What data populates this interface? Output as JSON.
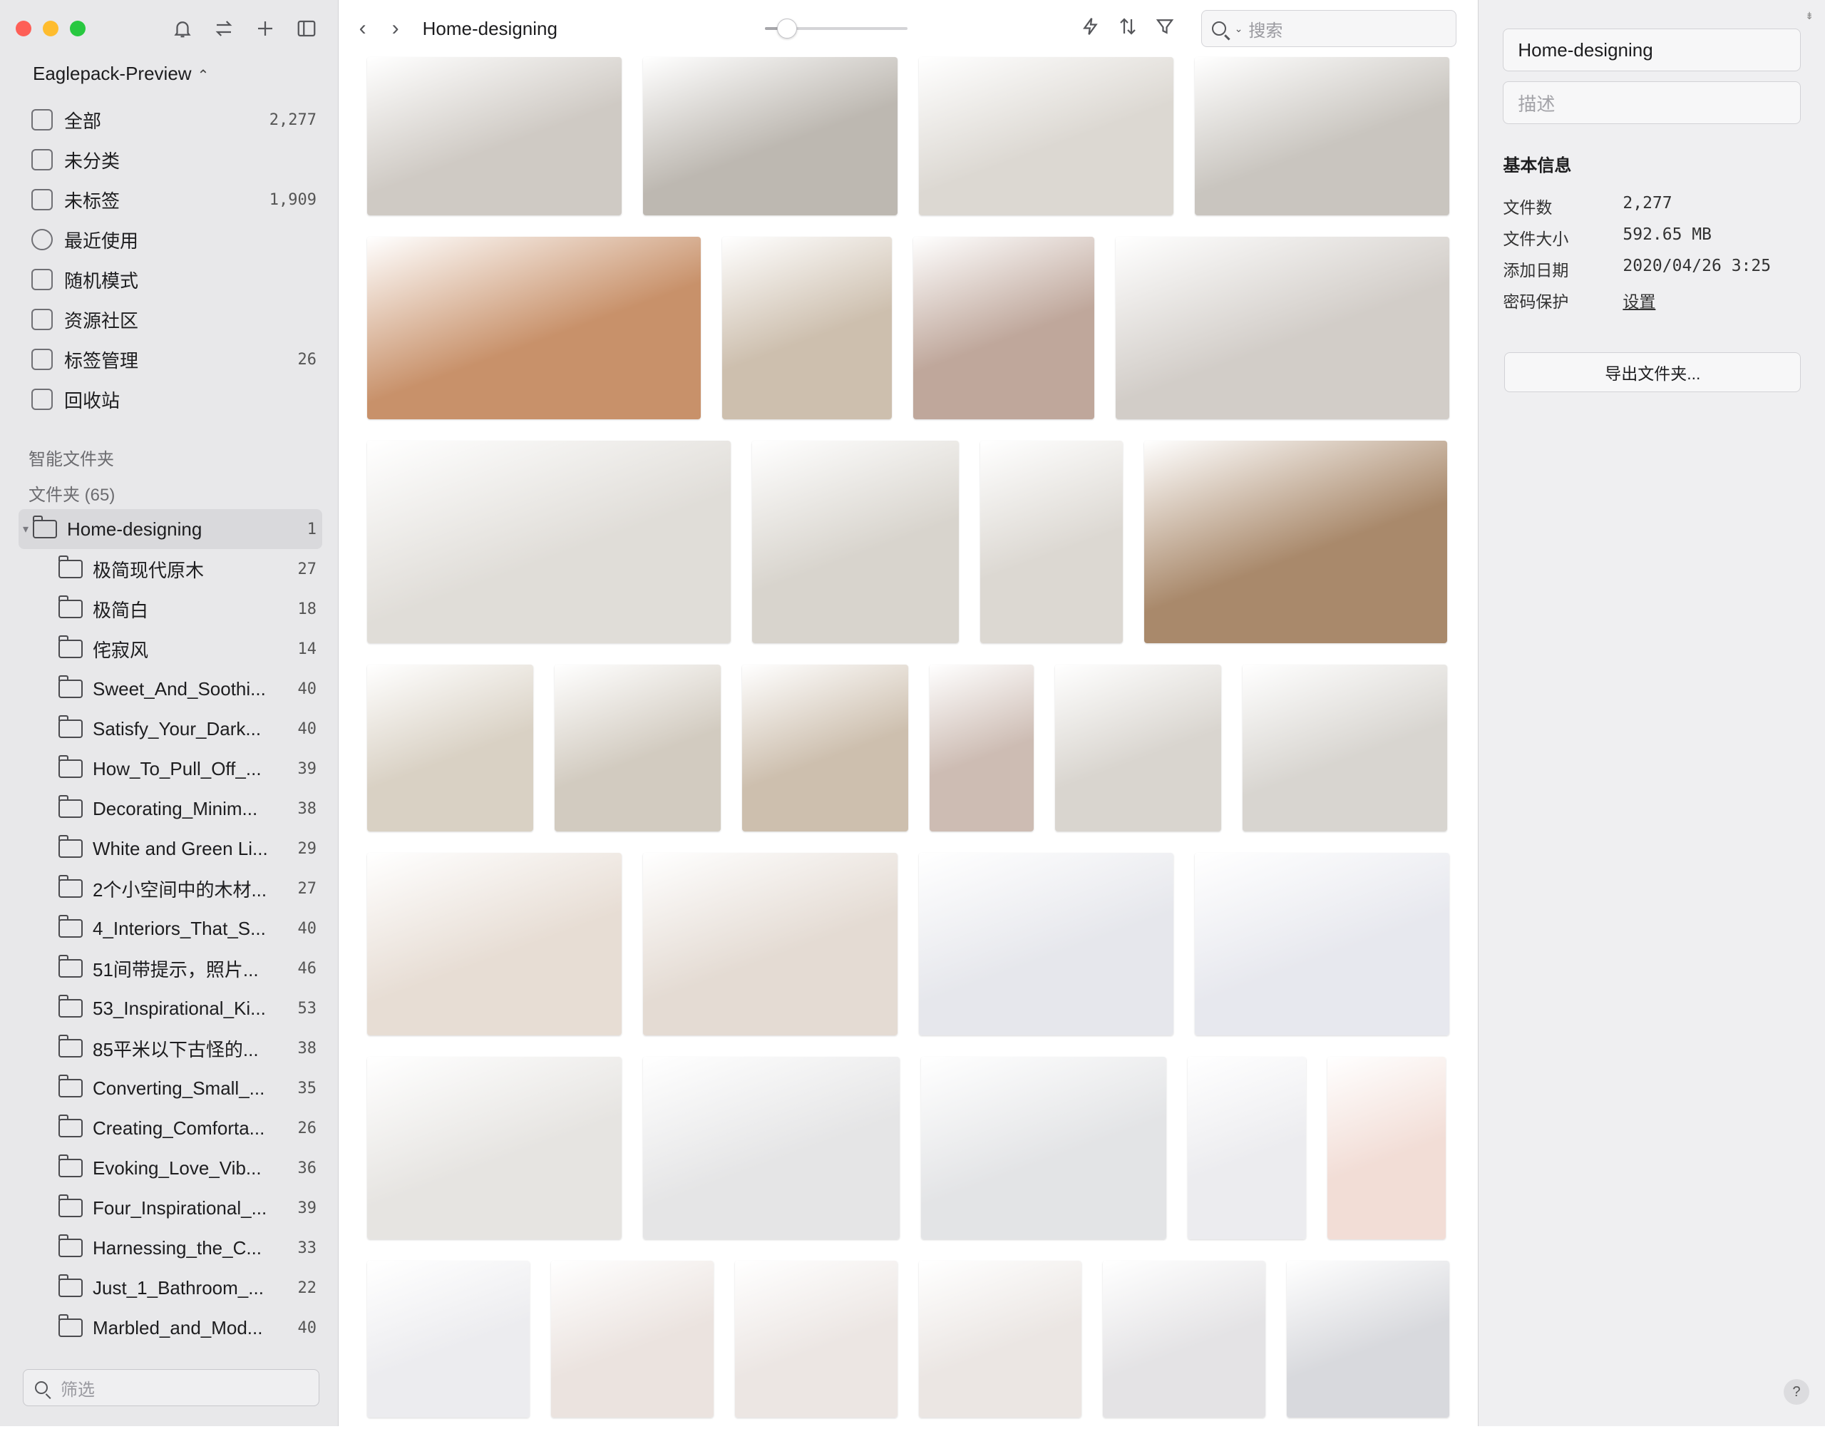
{
  "library": {
    "name": "Eaglepack-Preview",
    "switch_icon": "chevron-updown-icon"
  },
  "toolbar_icons": [
    "bell-icon",
    "sort-arrows-icon",
    "plus-icon",
    "sidebar-toggle-icon"
  ],
  "nav": [
    {
      "label": "全部",
      "count": "2,277",
      "icon": "all-items-icon"
    },
    {
      "label": "未分类",
      "count": "",
      "icon": "uncategorized-icon"
    },
    {
      "label": "未标签",
      "count": "1,909",
      "icon": "untagged-icon"
    },
    {
      "label": "最近使用",
      "count": "",
      "icon": "clock-icon"
    },
    {
      "label": "随机模式",
      "count": "",
      "icon": "shuffle-icon"
    },
    {
      "label": "资源社区",
      "count": "",
      "icon": "download-icon"
    },
    {
      "label": "标签管理",
      "count": "26",
      "icon": "bookmark-icon"
    },
    {
      "label": "回收站",
      "count": "",
      "icon": "trash-icon"
    }
  ],
  "sections": {
    "smart_folders": "智能文件夹",
    "folders": "文件夹 (65)"
  },
  "folder_tree": {
    "root": {
      "label": "Home-designing",
      "count": "1"
    },
    "children": [
      {
        "label": "极简现代原木",
        "count": "27"
      },
      {
        "label": "极简白",
        "count": "18"
      },
      {
        "label": "侘寂风",
        "count": "14"
      },
      {
        "label": "Sweet_And_Soothi...",
        "count": "40"
      },
      {
        "label": "Satisfy_Your_Dark...",
        "count": "40"
      },
      {
        "label": "How_To_Pull_Off_...",
        "count": "39"
      },
      {
        "label": "Decorating_Minim...",
        "count": "38"
      },
      {
        "label": "White and Green Li...",
        "count": "29"
      },
      {
        "label": "2个小空间中的木材...",
        "count": "27"
      },
      {
        "label": "4_Interiors_That_S...",
        "count": "40"
      },
      {
        "label": "51间带提示，照片...",
        "count": "46"
      },
      {
        "label": "53_Inspirational_Ki...",
        "count": "53"
      },
      {
        "label": "85平米以下古怪的...",
        "count": "38"
      },
      {
        "label": "Converting_Small_...",
        "count": "35"
      },
      {
        "label": "Creating_Comforta...",
        "count": "26"
      },
      {
        "label": "Evoking_Love_Vib...",
        "count": "36"
      },
      {
        "label": "Four_Inspirational_...",
        "count": "39"
      },
      {
        "label": "Harnessing_the_C...",
        "count": "33"
      },
      {
        "label": "Just_1_Bathroom_...",
        "count": "22"
      },
      {
        "label": "Marbled_and_Mod...",
        "count": "40"
      }
    ]
  },
  "filter": {
    "placeholder": "筛选"
  },
  "topbar": {
    "title": "Home-designing",
    "zoom": 0.15
  },
  "search": {
    "placeholder": "搜索"
  },
  "inspector": {
    "name": "Home-designing",
    "description_placeholder": "描述",
    "section_title": "基本信息",
    "fields": [
      {
        "key": "文件数",
        "value": "2,277"
      },
      {
        "key": "文件大小",
        "value": "592.65 MB"
      },
      {
        "key": "添加日期",
        "value": "2020/04/26 3:25"
      },
      {
        "key": "密码保护",
        "value": "设置"
      }
    ],
    "export_label": "导出文件夹...",
    "help": "?"
  },
  "grid_rows": [
    [
      "#cfcac4",
      "#bdb8b1",
      "#dcd8d2",
      "#c9c5bf"
    ],
    [
      "#c8916a",
      "#cdbfae",
      "#bfa79b",
      "#d2cdc8"
    ],
    [
      "#e0ddd8",
      "#d8d4cd",
      "#dcd8d2",
      "#a9896b"
    ],
    [
      "#d9d1c4",
      "#d2cbc0",
      "#cdbfae",
      "#cdbcb3",
      "#d9d5cf",
      "#d8d5d0"
    ],
    [
      "#e7ddd4",
      "#e4dbd3",
      "#e6e7ec",
      "#e7e8ee"
    ],
    [
      "#e6e4e1",
      "#e5e5e6",
      "#e3e4e6",
      "#ececef",
      "#f2ddd6"
    ],
    [
      "#ececef",
      "#ebe3df",
      "#ece6e3",
      "#ebe6e3",
      "#e4e3e5",
      "#d8d9dd"
    ]
  ]
}
